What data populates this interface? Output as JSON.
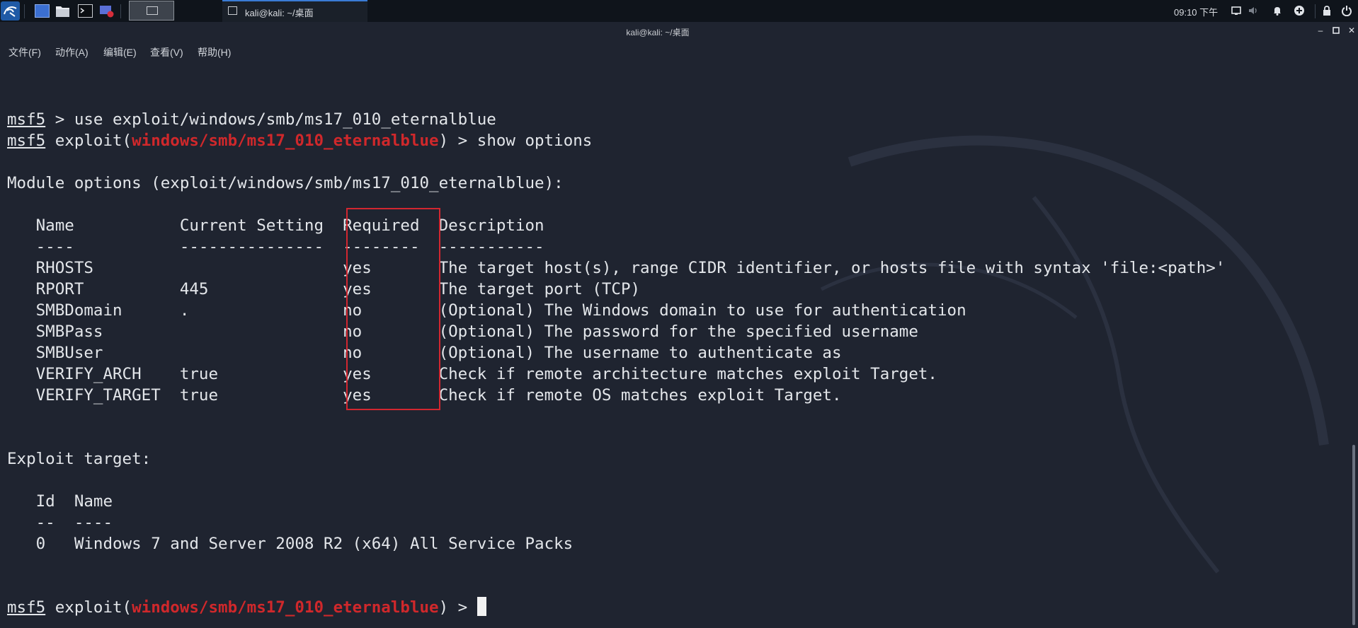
{
  "panel": {
    "taskbar_window_label": "kali@kali: ~/桌面",
    "clock": "09:10 下午",
    "launchers": [
      "desktop-icon",
      "file-manager-icon",
      "terminal-icon",
      "screen-recorder-icon"
    ],
    "tray_icons": [
      "display-icon",
      "volume-icon",
      "notification-bell-icon",
      "update-icon",
      "lock-icon",
      "power-icon"
    ]
  },
  "window": {
    "title": "kali@kali: ~/桌面"
  },
  "menubar": {
    "items": [
      "文件(F)",
      "动作(A)",
      "编辑(E)",
      "查看(V)",
      "帮助(H)"
    ]
  },
  "terminal": {
    "prompt": "msf5",
    "cmd_use": " > use exploit/windows/smb/ms17_010_eternalblue",
    "exploit_open": " exploit(",
    "module": "windows/smb/ms17_010_eternalblue",
    "cmd_show": ") > show options",
    "prompt_tail": ") > ",
    "module_options_heading": "Module options (exploit/windows/smb/ms17_010_eternalblue):",
    "options_header": "   Name           Current Setting  Required  Description",
    "options_rule": "   ----           ---------------  --------  -----------",
    "options_rows": [
      "   RHOSTS                          yes       The target host(s), range CIDR identifier, or hosts file with syntax 'file:<path>'",
      "   RPORT          445              yes       The target port (TCP)",
      "   SMBDomain      .                no        (Optional) The Windows domain to use for authentication",
      "   SMBPass                         no        (Optional) The password for the specified username",
      "   SMBUser                         no        (Optional) The username to authenticate as",
      "   VERIFY_ARCH    true             yes       Check if remote architecture matches exploit Target.",
      "   VERIFY_TARGET  true             yes       Check if remote OS matches exploit Target."
    ],
    "exploit_target_heading": "Exploit target:",
    "target_header": "   Id  Name",
    "target_rule": "   --  ----",
    "target_rows": [
      "   0   Windows 7 and Server 2008 R2 (x64) All Service Packs"
    ]
  },
  "colors": {
    "terminal_bg": "#1f2430",
    "module_red": "#d0282b",
    "highlight_box": "#d22730",
    "text": "#e3e6ea"
  }
}
